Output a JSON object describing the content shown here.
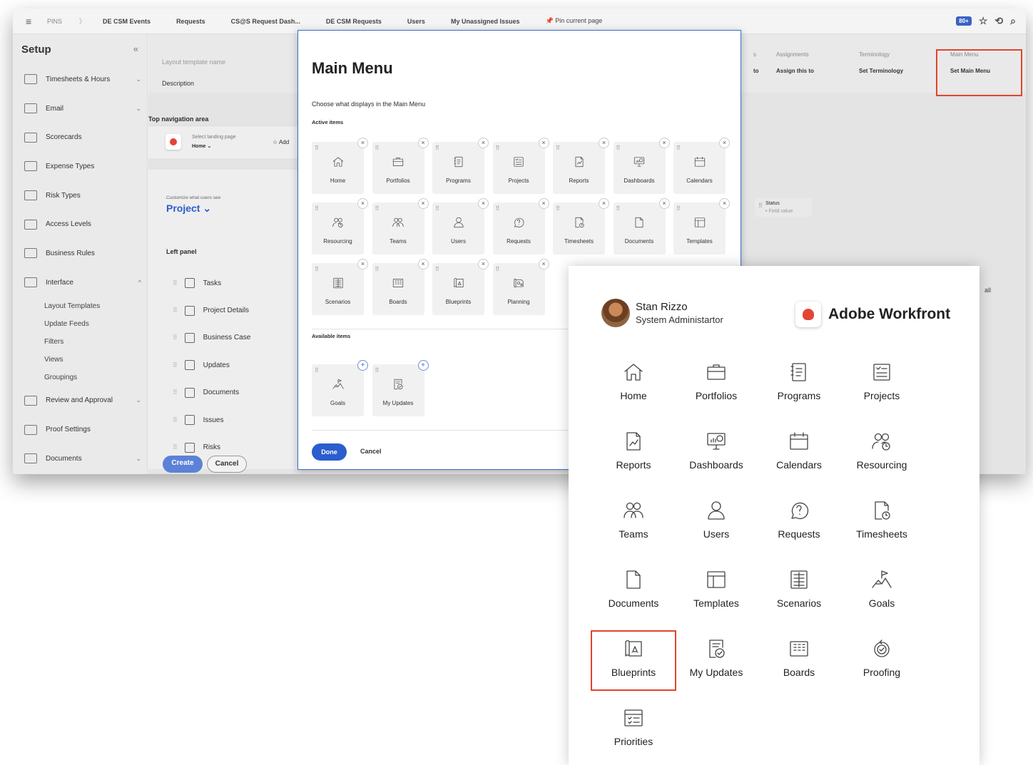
{
  "topbar": {
    "pins": "PINS",
    "items": [
      "DE CSM Events",
      "Requests",
      "CS@S Request Dash...",
      "DE CSM Requests",
      "Users",
      "My Unassigned Issues"
    ],
    "pin_current": "Pin current page",
    "badge": "80+"
  },
  "sidebar": {
    "title": "Setup",
    "items": [
      {
        "label": "Timesheets & Hours",
        "chev": "⌄"
      },
      {
        "label": "Email",
        "chev": "⌄"
      },
      {
        "label": "Scorecards",
        "chev": ""
      },
      {
        "label": "Expense Types",
        "chev": ""
      },
      {
        "label": "Risk Types",
        "chev": ""
      },
      {
        "label": "Access Levels",
        "chev": ""
      },
      {
        "label": "Business Rules",
        "chev": ""
      },
      {
        "label": "Interface",
        "chev": "^"
      }
    ],
    "sub_items": [
      "Layout Templates",
      "Update Feeds",
      "Filters",
      "Views",
      "Groupings"
    ],
    "items_after": [
      {
        "label": "Review and Approval",
        "chev": "⌄"
      },
      {
        "label": "Proof Settings",
        "chev": ""
      },
      {
        "label": "Documents",
        "chev": "⌄"
      }
    ]
  },
  "page": {
    "layout_name_placeholder": "Layout template name",
    "description": "Description",
    "top_nav": "Top navigation area",
    "select_landing": "Select landing page",
    "landing_value": "Home ⌄",
    "add": "Add",
    "customize": "Customize what users see",
    "object": "Project ⌄",
    "left_panel": "Left panel",
    "left_items": [
      "Tasks",
      "Project Details",
      "Business Case",
      "Updates",
      "Documents",
      "Issues",
      "Risks"
    ],
    "create": "Create",
    "cancel": "Cancel",
    "status": "Status",
    "field_value": "• Field value",
    "all": "all",
    "right_cols": [
      {
        "head": "s",
        "action": "to"
      },
      {
        "head": "Assignments",
        "action": "Assign this to"
      },
      {
        "head": "Terminology",
        "action": "Set Terminology"
      },
      {
        "head": "Main Menu",
        "action": "Set Main Menu"
      }
    ]
  },
  "modal": {
    "title": "Main Menu",
    "description": "Choose what displays in the Main Menu",
    "active_label": "Active items",
    "active_items": [
      "Home",
      "Portfolios",
      "Programs",
      "Projects",
      "Reports",
      "Dashboards",
      "Calendars",
      "Resourcing",
      "Teams",
      "Users",
      "Requests",
      "Timesheets",
      "Documents",
      "Templates",
      "Scenarios",
      "Boards",
      "Blueprints",
      "Planning"
    ],
    "available_label": "Available items",
    "available_items": [
      "Goals",
      "My Updates"
    ],
    "done": "Done",
    "cancel": "Cancel"
  },
  "main_menu": {
    "user_name": "Stan Rizzo",
    "user_role": "System Administartor",
    "brand": "Adobe Workfront",
    "items": [
      "Home",
      "Portfolios",
      "Programs",
      "Projects",
      "Reports",
      "Dashboards",
      "Calendars",
      "Resourcing",
      "Teams",
      "Users",
      "Requests",
      "Timesheets",
      "Documents",
      "Templates",
      "Scenarios",
      "Goals",
      "Blueprints",
      "My Updates",
      "Boards",
      "Proofing",
      "Priorities"
    ],
    "selected": "Blueprints"
  },
  "colors": {
    "accent": "#2b5dcd",
    "highlight": "#e0452e"
  }
}
